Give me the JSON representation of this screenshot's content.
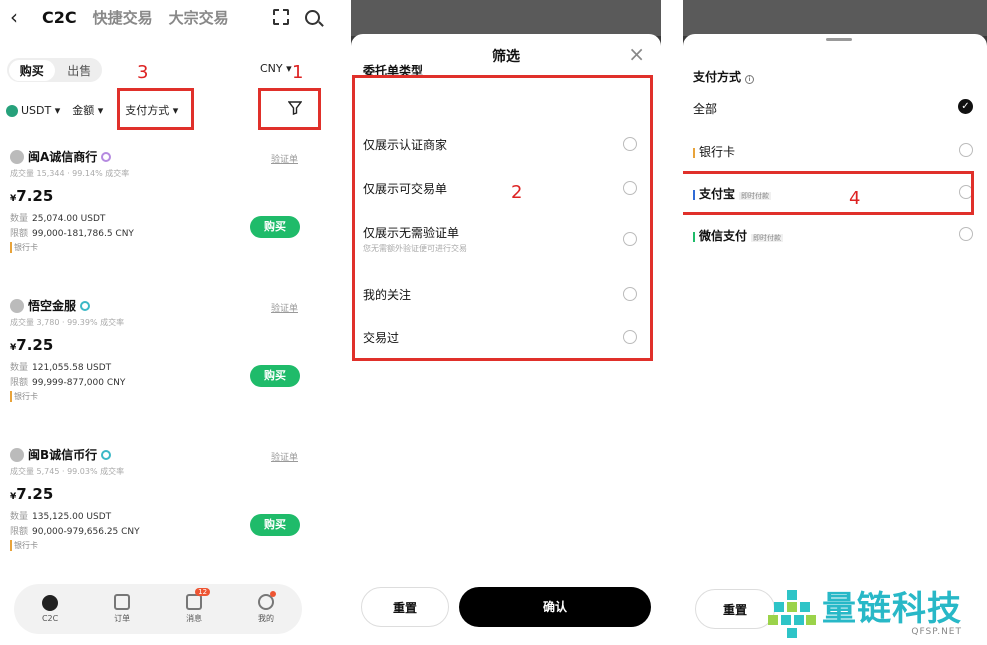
{
  "panel1": {
    "back": "‹",
    "tabs": [
      "C2C",
      "快捷交易",
      "大宗交易"
    ],
    "buy_sell": [
      "购买",
      "出售"
    ],
    "currency": "CNY ▾",
    "filters": {
      "coin": "USDT ▾",
      "amount": "金额 ▾",
      "payment": "支付方式 ▾"
    },
    "labels": {
      "one": "1",
      "three": "3"
    },
    "merchants": [
      {
        "name": "闽A诚信商行",
        "verify": "验证单",
        "stat": "成交量 15,344 · 99.14% 成交率",
        "price": "7.25",
        "qty_label": "数量",
        "qty": "25,074.00 USDT",
        "limit_label": "限额",
        "limit": "99,000-181,786.5 CNY",
        "pay": "银行卡",
        "buy": "购买"
      },
      {
        "name": "悟空金服",
        "verify": "验证单",
        "stat": "成交量 3,780 · 99.39% 成交率",
        "price": "7.25",
        "qty_label": "数量",
        "qty": "121,055.58 USDT",
        "limit_label": "限额",
        "limit": "99,999-877,000 CNY",
        "pay": "银行卡",
        "buy": "购买"
      },
      {
        "name": "闽B诚信币行",
        "verify": "验证单",
        "stat": "成交量 5,745 · 99.03% 成交率",
        "price": "7.25",
        "qty_label": "数量",
        "qty": "135,125.00 USDT",
        "limit_label": "限额",
        "limit": "90,000-979,656.25 CNY",
        "pay": "银行卡",
        "buy": "购买"
      }
    ],
    "nav": [
      {
        "label": "C2C"
      },
      {
        "label": "订单"
      },
      {
        "label": "消息",
        "badge": "12"
      },
      {
        "label": "我的"
      }
    ]
  },
  "panel2": {
    "title": "筛选",
    "close": "×",
    "group": "委托单类型",
    "options": [
      {
        "label": "仅展示认证商家",
        "sub": ""
      },
      {
        "label": "仅展示可交易单",
        "sub": ""
      },
      {
        "label": "仅展示无需验证单",
        "sub": "您无需额外验证便可进行交易"
      },
      {
        "label": "我的关注",
        "sub": ""
      },
      {
        "label": "交易过",
        "sub": ""
      }
    ],
    "label_two": "2",
    "reset": "重置",
    "confirm": "确认"
  },
  "panel3": {
    "section": "支付方式",
    "info": "i",
    "options": [
      {
        "label": "全部",
        "tag": "",
        "bar_color": ""
      },
      {
        "label": "银行卡",
        "tag": "",
        "bar_color": "#e8a33a"
      },
      {
        "label": "支付宝",
        "tag": "即时付款",
        "bar_color": "#2f6bd6"
      },
      {
        "label": "微信支付",
        "tag": "即时付款",
        "bar_color": "#1fbb6a"
      }
    ],
    "label_four": "4",
    "reset": "重置"
  },
  "watermark": {
    "cn": "量链科技",
    "en": "QFSP.NET"
  }
}
